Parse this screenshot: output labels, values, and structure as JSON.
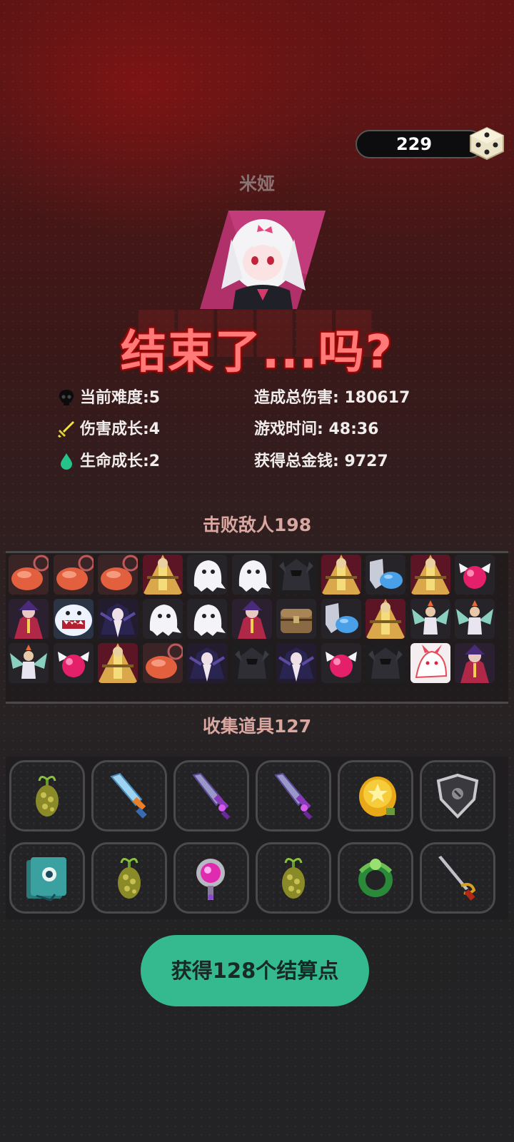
{
  "currency": {
    "value": "229",
    "icon": "dice-icon"
  },
  "hero": {
    "name": "米娅",
    "portrait": "white-haired-girl-portrait"
  },
  "title": "结束了...吗?",
  "stats": {
    "difficulty": "当前难度:5",
    "damage_growth": "伤害成长:4",
    "life_growth": "生命成长:2",
    "total_damage": "造成总伤害: 180617",
    "play_time": "游戏时间: 48:36",
    "total_gold": "获得总金钱: 9727"
  },
  "colors": {
    "title": "#ff7a78",
    "button": "#35b98f",
    "difficulty_icon": "#111111",
    "damage_icon": "#f2e540",
    "life_icon": "#25c28a"
  },
  "enemies_title": "击败敌人198",
  "enemies": [
    [
      "slime",
      "slime",
      "slime",
      "golden-warrior",
      "ghost",
      "ghost",
      "dark-knight",
      "golden-warrior",
      "shield-slime",
      "golden-warrior",
      "pink-orb"
    ],
    [
      "purple-mage",
      "yeti",
      "dark-witch",
      "ghost",
      "ghost",
      "purple-mage",
      "chest-mimic",
      "shield-slime",
      "golden-warrior",
      "winged-archer",
      "winged-archer"
    ],
    [
      "winged-archer",
      "pink-orb",
      "golden-warrior",
      "slime",
      "dark-witch",
      "dark-knight",
      "dark-witch",
      "pink-orb",
      "dark-knight",
      "white-fox",
      "purple-mage"
    ]
  ],
  "items_title": "收集道具127",
  "items": [
    [
      "spore-plant",
      "ice-sword",
      "purple-sword",
      "purple-sword",
      "gold-coin-pouch",
      "dark-shield"
    ],
    [
      "eye-book",
      "spore-plant",
      "orb-staff",
      "spore-plant",
      "jade-ring",
      "rapier"
    ]
  ],
  "claim_button": "获得128个结算点"
}
